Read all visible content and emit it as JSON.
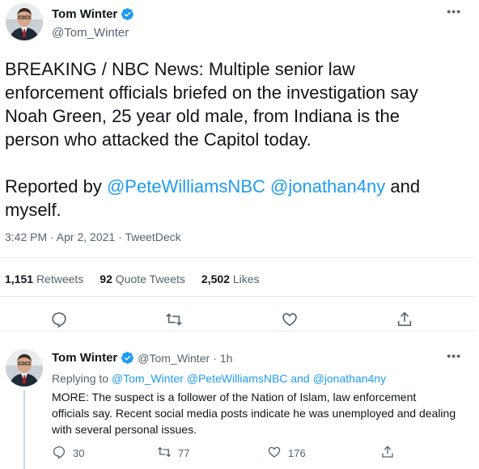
{
  "main_tweet": {
    "author_name": "Tom Winter",
    "author_handle": "@Tom_Winter",
    "more_icon": "more-dots-icon",
    "text_plain": "BREAKING / NBC News: Multiple senior law enforcement officials briefed on the investigation say Noah Green, 25 year old male, from Indiana is the person who attacked the Capitol today.\n\nReported by ",
    "mention_1": "@PeteWilliamsNBC",
    "mention_2": "@jonathan4ny",
    "text_end": "and myself.",
    "timestamp": "3:42 PM · Apr 2, 2021 · TweetDeck",
    "stats": {
      "retweets_count": "1,151",
      "retweets_label": "Retweets",
      "quotes_count": "92",
      "quotes_label": "Quote Tweets",
      "likes_count": "2,502",
      "likes_label": "Likes"
    },
    "actions": [
      "reply-icon",
      "retweet-icon",
      "like-icon",
      "share-icon"
    ]
  },
  "reply_tweet": {
    "author_name": "Tom Winter",
    "author_handle": "@Tom_Winter",
    "separator": "·",
    "age": "1h",
    "replying_prefix": "Replying to",
    "replying_user_1": "@Tom_Winter",
    "replying_user_2": "@PeteWilliamsNBC",
    "replying_and": "and",
    "replying_user_3": "@jonathan4ny",
    "text": "MORE: The suspect is a follower of the Nation of Islam, law enforcement officials say. Recent social media posts indicate he was unemployed and dealing with several personal issues.",
    "reply_count": "30",
    "retweet_count": "77",
    "like_count": "176"
  },
  "colors": {
    "accent": "#1d9bf0",
    "text": "#0f1419",
    "muted": "#536471",
    "divider": "#e6ecf0"
  }
}
